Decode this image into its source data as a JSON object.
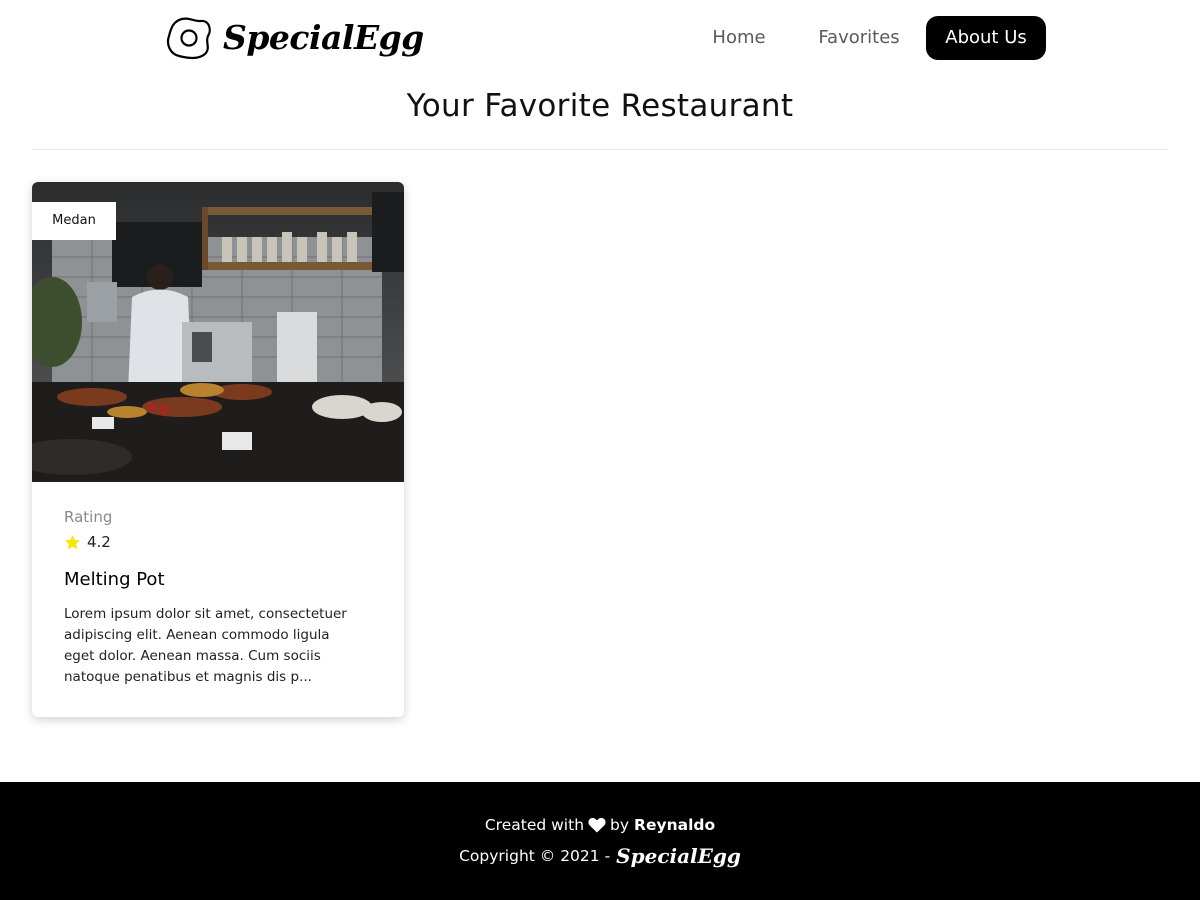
{
  "header": {
    "brand": "SpecialEgg",
    "logo_icon": "fried-egg-icon",
    "nav": [
      {
        "label": "Home",
        "active": false
      },
      {
        "label": "Favorites",
        "active": false
      },
      {
        "label": "About Us",
        "active": true
      }
    ]
  },
  "main": {
    "title": "Your Favorite Restaurant",
    "restaurants": [
      {
        "city": "Medan",
        "image_icon": "restaurant-photo",
        "rating_label": "Rating",
        "rating_icon": "star-icon",
        "rating": "4.2",
        "name": "Melting Pot",
        "description": "Lorem ipsum dolor sit amet, consectetuer adipiscing elit. Aenean commodo ligula eget dolor. Aenean massa. Cum sociis natoque penatibus et magnis dis p..."
      }
    ]
  },
  "footer": {
    "created_prefix": "Created with",
    "heart_icon": "heart-icon",
    "created_by": "by",
    "author": "Reynaldo",
    "copyright": "Copyright © 2021 -",
    "brand": "SpecialEgg"
  },
  "colors": {
    "nav_active_bg": "#000000",
    "nav_text": "#5a5a5a",
    "footer_bg": "#000000",
    "star": "#f7e600",
    "muted": "#8a8a8a"
  }
}
